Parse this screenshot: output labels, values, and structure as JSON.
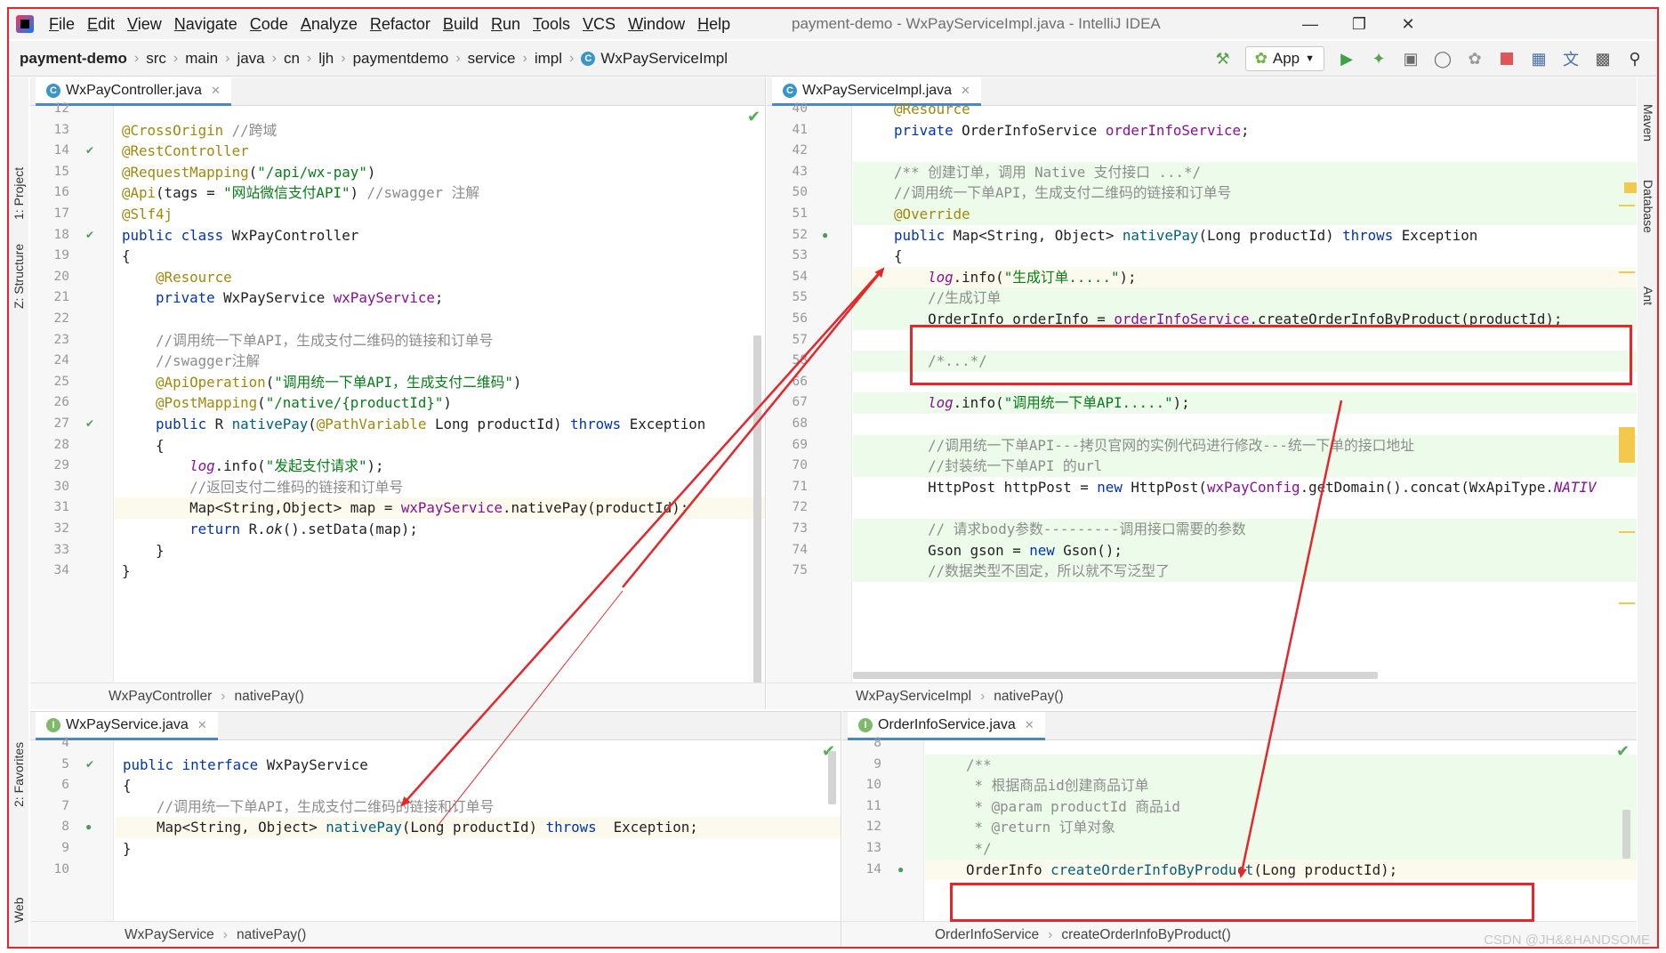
{
  "menu": [
    "File",
    "Edit",
    "View",
    "Navigate",
    "Code",
    "Analyze",
    "Refactor",
    "Build",
    "Run",
    "Tools",
    "VCS",
    "Window",
    "Help"
  ],
  "window_title": "payment-demo - WxPayServiceImpl.java - IntelliJ IDEA",
  "window_controls": {
    "minimize": "—",
    "restore": "❐",
    "close": "✕"
  },
  "nav": {
    "crumbs": [
      "payment-demo",
      "src",
      "main",
      "java",
      "cn",
      "ljh",
      "paymentdemo",
      "service",
      "impl",
      "WxPayServiceImpl"
    ],
    "run_config": "App"
  },
  "side": {
    "left_tabs": [
      "1: Project",
      "Z: Structure",
      "2: Favorites",
      "Web"
    ],
    "right_tabs": [
      "Maven",
      "Database",
      "Ant"
    ]
  },
  "panes": {
    "top_left": {
      "tab": "WxPayController.java",
      "breadcrumb": [
        "WxPayController",
        "nativePay()"
      ],
      "lines": [
        {
          "n": "12",
          "parts": []
        },
        {
          "n": "13",
          "parts": [
            [
              "ann",
              "@CrossOrigin "
            ],
            [
              "cmt",
              "//跨域"
            ]
          ]
        },
        {
          "n": "14",
          "parts": [
            [
              "ann",
              "@RestController"
            ]
          ]
        },
        {
          "n": "15",
          "parts": [
            [
              "ann",
              "@RequestMapping"
            ],
            [
              "",
              "("
            ],
            [
              "str",
              "\"/api/wx-pay\""
            ],
            [
              "",
              ")"
            ]
          ]
        },
        {
          "n": "16",
          "parts": [
            [
              "ann",
              "@Api"
            ],
            [
              "",
              "(tags = "
            ],
            [
              "str",
              "\"网站微信支付API\""
            ],
            [
              "",
              ") "
            ],
            [
              "cmt",
              "//swagger 注解"
            ]
          ]
        },
        {
          "n": "17",
          "parts": [
            [
              "ann",
              "@Slf4j"
            ]
          ]
        },
        {
          "n": "18",
          "parts": [
            [
              "kw",
              "public class "
            ],
            [
              "",
              "WxPayController"
            ]
          ]
        },
        {
          "n": "19",
          "parts": [
            [
              "",
              "{"
            ]
          ]
        },
        {
          "n": "20",
          "parts": [
            [
              "ann",
              "    @Resource"
            ]
          ]
        },
        {
          "n": "21",
          "parts": [
            [
              "kw",
              "    private "
            ],
            [
              "",
              "WxPayService "
            ],
            [
              "fld",
              "wxPayService"
            ],
            [
              "",
              ";"
            ]
          ]
        },
        {
          "n": "22",
          "parts": []
        },
        {
          "n": "23",
          "parts": [
            [
              "cmt",
              "    //调用统一下单API，生成支付二维码的链接和订单号"
            ]
          ]
        },
        {
          "n": "24",
          "parts": [
            [
              "cmt",
              "    //swagger注解"
            ]
          ]
        },
        {
          "n": "25",
          "parts": [
            [
              "ann",
              "    @ApiOperation"
            ],
            [
              "",
              "("
            ],
            [
              "str",
              "\"调用统一下单API，生成支付二维码\""
            ],
            [
              "",
              ")"
            ]
          ]
        },
        {
          "n": "26",
          "parts": [
            [
              "ann",
              "    @PostMapping"
            ],
            [
              "",
              "("
            ],
            [
              "str",
              "\"/native/{productId}\""
            ],
            [
              "",
              ")"
            ]
          ]
        },
        {
          "n": "27",
          "parts": [
            [
              "kw",
              "    public "
            ],
            [
              "",
              "R "
            ],
            [
              "mth",
              "nativePay"
            ],
            [
              "",
              "("
            ],
            [
              "ann",
              "@PathVariable "
            ],
            [
              "",
              "Long productId) "
            ],
            [
              "kw",
              "throws "
            ],
            [
              "",
              "Exception"
            ]
          ]
        },
        {
          "n": "28",
          "parts": [
            [
              "",
              "    {"
            ]
          ]
        },
        {
          "n": "29",
          "parts": [
            [
              "fld it",
              "        log"
            ],
            [
              "",
              ".info("
            ],
            [
              "str",
              "\"发起支付请求\""
            ],
            [
              "",
              ");"
            ]
          ]
        },
        {
          "n": "30",
          "parts": [
            [
              "cmt",
              "        //返回支付二维码的链接和订单号"
            ]
          ]
        },
        {
          "n": "31",
          "parts": [
            [
              "",
              "        Map<String,Object> map = "
            ],
            [
              "fld",
              "wxPayService"
            ],
            [
              "",
              ".nativePay(productId);"
            ]
          ]
        },
        {
          "n": "32",
          "parts": [
            [
              "kw",
              "        return "
            ],
            [
              "",
              "R."
            ],
            [
              "it",
              "ok"
            ],
            [
              "",
              "().setData(map);"
            ]
          ]
        },
        {
          "n": "33",
          "parts": [
            [
              "",
              "    }"
            ]
          ]
        },
        {
          "n": "34",
          "parts": [
            [
              "",
              "}"
            ]
          ]
        }
      ]
    },
    "top_right": {
      "tab": "WxPayServiceImpl.java",
      "breadcrumb": [
        "WxPayServiceImpl",
        "nativePay()"
      ],
      "lines": [
        {
          "n": "40",
          "parts": [
            [
              "ann",
              "    @Resource"
            ]
          ]
        },
        {
          "n": "41",
          "parts": [
            [
              "kw",
              "    private "
            ],
            [
              "",
              "OrderInfoService "
            ],
            [
              "fld",
              "orderInfoService"
            ],
            [
              "",
              ";"
            ]
          ]
        },
        {
          "n": "42",
          "parts": []
        },
        {
          "n": "43",
          "parts": [
            [
              "doc",
              "    /** 创建订单，调用 Native 支付接口 ...*/"
            ]
          ]
        },
        {
          "n": "50",
          "parts": [
            [
              "cmt",
              "    //调用统一下单API，生成支付二维码的链接和订单号"
            ]
          ]
        },
        {
          "n": "51",
          "parts": [
            [
              "ann",
              "    @Override"
            ]
          ]
        },
        {
          "n": "52",
          "parts": [
            [
              "kw",
              "    public "
            ],
            [
              "",
              "Map<String, Object> "
            ],
            [
              "mth",
              "nativePay"
            ],
            [
              "",
              "(Long productId) "
            ],
            [
              "kw",
              "throws "
            ],
            [
              "",
              "Exception"
            ]
          ]
        },
        {
          "n": "53",
          "parts": [
            [
              "",
              "    {"
            ]
          ]
        },
        {
          "n": "54",
          "parts": [
            [
              "fld it",
              "        log"
            ],
            [
              "",
              ".info("
            ],
            [
              "str",
              "\"生成订单.....\""
            ],
            [
              "",
              ");"
            ]
          ]
        },
        {
          "n": "55",
          "parts": [
            [
              "cmt",
              "        //生成订单"
            ]
          ]
        },
        {
          "n": "56",
          "parts": [
            [
              "",
              "        OrderInfo orderInfo = "
            ],
            [
              "fld",
              "orderInfoService"
            ],
            [
              "",
              ".createOrderInfoByProduct(productId);"
            ]
          ]
        },
        {
          "n": "57",
          "parts": []
        },
        {
          "n": "58",
          "parts": [
            [
              "doc",
              "        /*...*/"
            ]
          ]
        },
        {
          "n": "66",
          "parts": []
        },
        {
          "n": "67",
          "parts": [
            [
              "fld it",
              "        log"
            ],
            [
              "",
              ".info("
            ],
            [
              "str",
              "\"调用统一下单API.....\""
            ],
            [
              "",
              ");"
            ]
          ]
        },
        {
          "n": "68",
          "parts": []
        },
        {
          "n": "69",
          "parts": [
            [
              "cmt",
              "        //调用统一下单API---拷贝官网的实例代码进行修改---统一下单的接口地址"
            ]
          ]
        },
        {
          "n": "70",
          "parts": [
            [
              "cmt",
              "        //封装统一下单API 的url"
            ]
          ]
        },
        {
          "n": "71",
          "parts": [
            [
              "",
              "        HttpPost httpPost = "
            ],
            [
              "kw",
              "new "
            ],
            [
              "",
              "HttpPost("
            ],
            [
              "fld",
              "wxPayConfig"
            ],
            [
              "",
              ".getDomain().concat(WxApiType."
            ],
            [
              "fld it",
              "NATIV"
            ]
          ]
        },
        {
          "n": "72",
          "parts": []
        },
        {
          "n": "73",
          "parts": [
            [
              "cmt",
              "        // 请求body参数---------调用接口需要的参数"
            ]
          ]
        },
        {
          "n": "74",
          "parts": [
            [
              "",
              "        Gson gson = "
            ],
            [
              "kw",
              "new "
            ],
            [
              "",
              "Gson();"
            ]
          ]
        },
        {
          "n": "75",
          "parts": [
            [
              "cmt",
              "        //数据类型不固定，所以就不写泛型了"
            ]
          ]
        }
      ]
    },
    "bottom_left": {
      "tab": "WxPayService.java",
      "breadcrumb": [
        "WxPayService",
        "nativePay()"
      ],
      "lines": [
        {
          "n": "4",
          "parts": []
        },
        {
          "n": "5",
          "parts": [
            [
              "kw",
              "public interface "
            ],
            [
              "",
              "WxPayService"
            ]
          ]
        },
        {
          "n": "6",
          "parts": [
            [
              "",
              "{"
            ]
          ]
        },
        {
          "n": "7",
          "parts": [
            [
              "cmt",
              "    //调用统一下单API，生成支付二维码的链接和订单号"
            ]
          ]
        },
        {
          "n": "8",
          "parts": [
            [
              "",
              "    Map<String, Object> "
            ],
            [
              "mth",
              "nativePay"
            ],
            [
              "",
              "(Long productId) "
            ],
            [
              "kw",
              "throws  "
            ],
            [
              "",
              "Exception;"
            ]
          ]
        },
        {
          "n": "9",
          "parts": [
            [
              "",
              "}"
            ]
          ]
        },
        {
          "n": "10",
          "parts": []
        }
      ]
    },
    "bottom_right": {
      "tab": "OrderInfoService.java",
      "breadcrumb": [
        "OrderInfoService",
        "createOrderInfoByProduct()"
      ],
      "lines": [
        {
          "n": "8",
          "parts": []
        },
        {
          "n": "9",
          "parts": [
            [
              "doc",
              "    /**"
            ]
          ]
        },
        {
          "n": "10",
          "parts": [
            [
              "doc",
              "     * 根据商品id创建商品订单"
            ]
          ]
        },
        {
          "n": "11",
          "parts": [
            [
              "doc",
              "     * @param productId 商品id"
            ]
          ]
        },
        {
          "n": "12",
          "parts": [
            [
              "doc",
              "     * @return 订单对象"
            ]
          ]
        },
        {
          "n": "13",
          "parts": [
            [
              "doc",
              "     */"
            ]
          ]
        },
        {
          "n": "14",
          "parts": [
            [
              "",
              "    OrderInfo "
            ],
            [
              "mth",
              "createOrderInfoByProduct"
            ],
            [
              "",
              "(Long productId);"
            ]
          ]
        }
      ]
    }
  },
  "watermark": "CSDN @JH&&HANDSOME",
  "colors": {
    "frame": "#e6262a",
    "keyword": "#0033b3",
    "annotation": "#9e880d",
    "string": "#067d17",
    "comment": "#8c8c8c",
    "field": "#871094"
  }
}
